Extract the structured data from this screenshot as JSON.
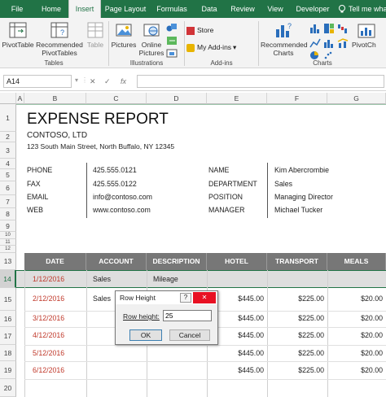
{
  "tabs": [
    "File",
    "Home",
    "Insert",
    "Page Layout",
    "Formulas",
    "Data",
    "Review",
    "View",
    "Developer",
    "Tell me wha"
  ],
  "active_tab": "Insert",
  "ribbon": {
    "pivottable": "PivotTable",
    "recommended_pivottables": [
      "Recommended",
      "PivotTables"
    ],
    "table": "Table",
    "pictures": "Pictures",
    "online_pictures": [
      "Online",
      "Pictures"
    ],
    "store": "Store",
    "my_addins": "My Add-ins",
    "recommended_charts": [
      "Recommended",
      "Charts"
    ],
    "pivotchart": "PivotCh",
    "groups": {
      "tables": "Tables",
      "illustrations": "Illustrations",
      "addins": "Add-ins",
      "charts": "Charts"
    }
  },
  "formula_bar": {
    "name_box": "A14",
    "cancel": "✕",
    "enter": "✓",
    "fx": "fx",
    "value": ""
  },
  "columns": [
    "A",
    "B",
    "C",
    "D",
    "E",
    "F",
    "G"
  ],
  "rows": [
    "1",
    "2",
    "3",
    "4",
    "5",
    "6",
    "7",
    "8",
    "9",
    "10",
    "11",
    "12",
    "13",
    "14",
    "15",
    "16",
    "17",
    "18",
    "19",
    "20"
  ],
  "report": {
    "title": "EXPENSE REPORT",
    "company": "CONTOSO, LTD",
    "address": "123 South Main Street, North Buffalo, NY 12345"
  },
  "contact": {
    "labels": [
      "PHONE",
      "FAX",
      "EMAIL",
      "WEB"
    ],
    "values": [
      "425.555.0121",
      "425.555.0122",
      "info@contoso.com",
      "www.contoso.com"
    ]
  },
  "employee": {
    "labels": [
      "NAME",
      "DEPARTMENT",
      "POSITION",
      "MANAGER"
    ],
    "values": [
      "Kim Abercrombie",
      "Sales",
      "Managing Director",
      "Michael Tucker"
    ]
  },
  "table": {
    "headers": [
      "DATE",
      "ACCOUNT",
      "DESCRIPTION",
      "HOTEL",
      "TRANSPORT",
      "MEALS"
    ],
    "rows": [
      [
        "1/12/2016",
        "Sales",
        "Mileage",
        "",
        "",
        ""
      ],
      [
        "2/12/2016",
        "Sales",
        "",
        "$445.00",
        "$225.00",
        "$20.00"
      ],
      [
        "3/12/2016",
        "",
        "",
        "$445.00",
        "$225.00",
        "$20.00"
      ],
      [
        "4/12/2016",
        "",
        "",
        "$445.00",
        "$225.00",
        "$20.00"
      ],
      [
        "5/12/2016",
        "",
        "",
        "$445.00",
        "$225.00",
        "$20.00"
      ],
      [
        "6/12/2016",
        "",
        "",
        "$445.00",
        "$225.00",
        "$20.00"
      ]
    ],
    "date_color": "#c0392b"
  },
  "dialog": {
    "title": "Row Height",
    "help": "?",
    "close": "✕",
    "label": "Row height:",
    "value": "25",
    "ok": "OK",
    "cancel": "Cancel"
  },
  "colors": {
    "brand": "#217346",
    "header_fill": "#777777",
    "selection": "#217346"
  }
}
